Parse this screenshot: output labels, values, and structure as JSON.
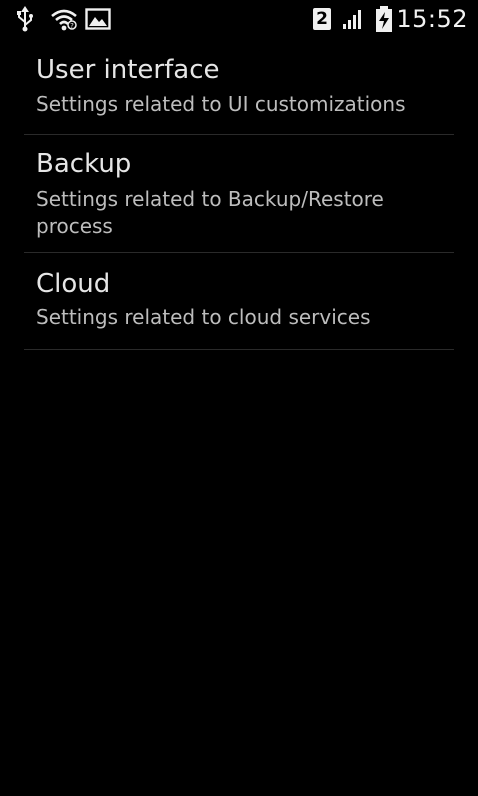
{
  "status_bar": {
    "icons": [
      "usb-icon",
      "wifi-icon",
      "image-notification-icon",
      "sim2-icon",
      "signal-icon",
      "battery-charging-icon"
    ],
    "sim_number": "2",
    "time": "15:52"
  },
  "settings": {
    "items": [
      {
        "title": "User interface",
        "summary": "Settings related to UI customizations"
      },
      {
        "title": "Backup",
        "summary": "Settings related to Backup/Restore process"
      },
      {
        "title": "Cloud",
        "summary": "Settings related to cloud services"
      }
    ]
  },
  "colors": {
    "background": "#000000",
    "title_text": "#e6e6e6",
    "summary_text": "#bdbdbd",
    "divider": "#2a2a2a",
    "status_icons": "#f0f0f0"
  }
}
